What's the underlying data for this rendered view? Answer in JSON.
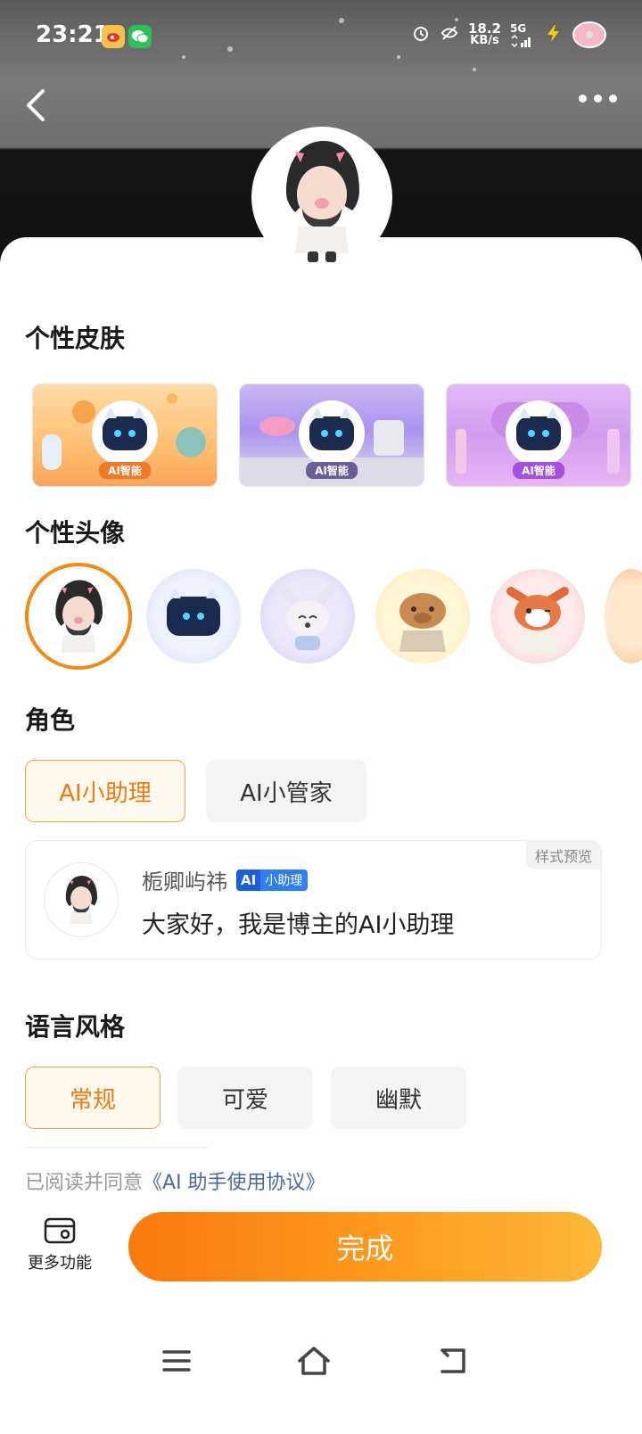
{
  "status_bar": {
    "time": "23:21",
    "speed_value": "18.2",
    "speed_unit": "KB/s",
    "network": "5G",
    "icons": [
      "weibo-icon",
      "wechat-icon",
      "alarm-icon",
      "eye-off-icon",
      "signal-icon",
      "charging-icon",
      "donut-icon"
    ]
  },
  "nav": {
    "back_icon": "chevron-left-icon",
    "more_icon": "more-dots-icon"
  },
  "sections": {
    "skin": "个性皮肤",
    "avatar": "个性头像",
    "role": "角色",
    "language_style": "语言风格"
  },
  "skins": [
    {
      "name": "orange",
      "badge": "AI智能"
    },
    {
      "name": "purple",
      "badge": "AI智能"
    },
    {
      "name": "pink",
      "badge": "AI智能"
    }
  ],
  "avatars": [
    {
      "name": "user-photo",
      "selected": true
    },
    {
      "name": "robot-cat",
      "selected": false
    },
    {
      "name": "fox",
      "selected": false
    },
    {
      "name": "capybara",
      "selected": false
    },
    {
      "name": "red-panda",
      "selected": false
    }
  ],
  "roles": {
    "active": "AI小助理",
    "other": "AI小管家"
  },
  "preview": {
    "tag": "样式预览",
    "name": "栀卿屿祎",
    "badge_logo": "AI",
    "badge_text": "小助理",
    "message": "大家好，我是博主的AI小助理"
  },
  "styles": {
    "normal": "常规",
    "cute": "可爱",
    "humor": "幽默"
  },
  "agreement": {
    "prefix": "已阅读并同意",
    "link": "《AI 助手使用协议》"
  },
  "bottom": {
    "more_label": "更多功能",
    "done_label": "完成"
  },
  "colors": {
    "accent": "#f28a12",
    "link": "#4a6a9a",
    "badge_blue": "#2f7ff0"
  }
}
